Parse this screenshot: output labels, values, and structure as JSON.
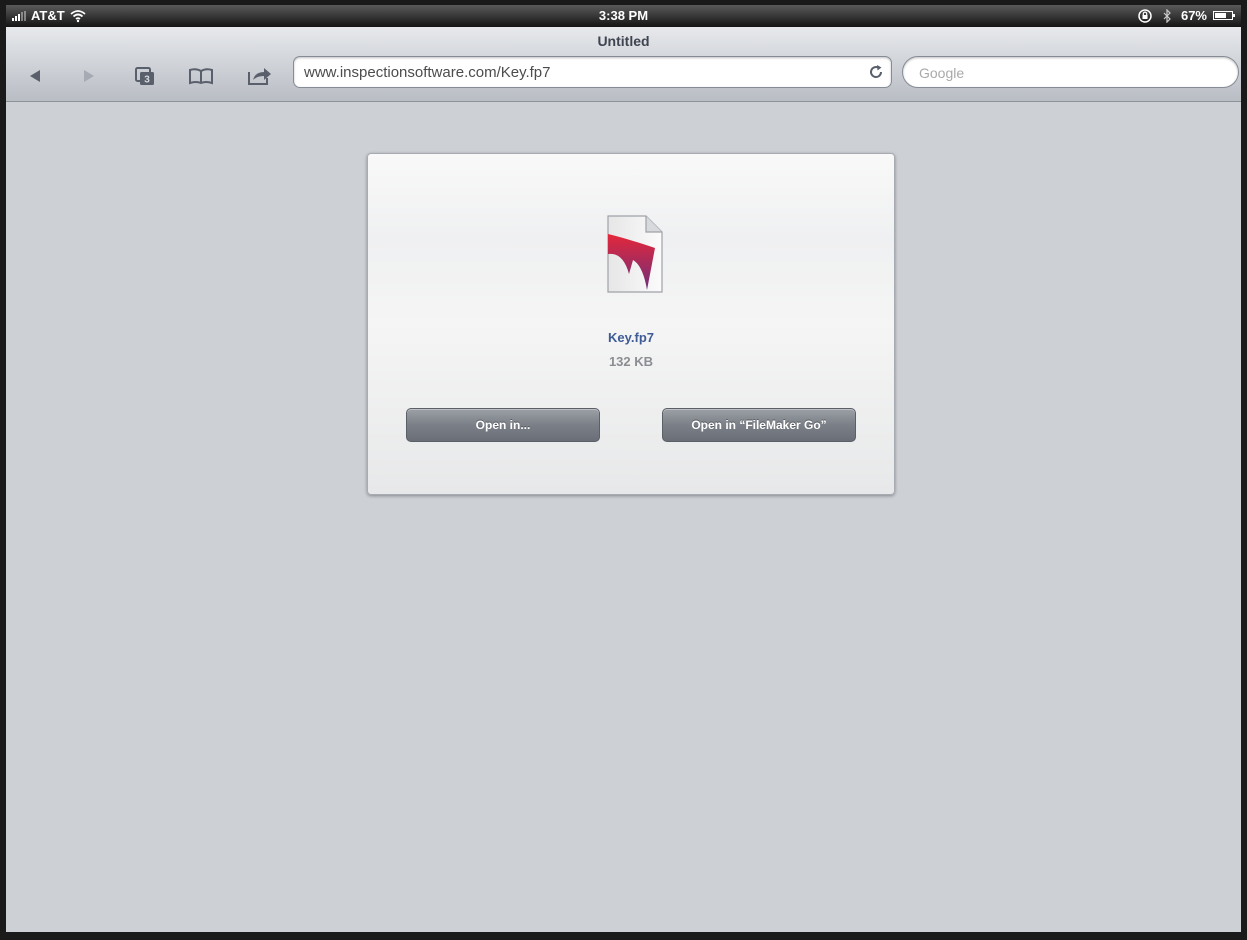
{
  "status_bar": {
    "carrier": "AT&T",
    "time": "3:38 PM",
    "battery": "67%",
    "battery_level": 0.67
  },
  "browser": {
    "page_title": "Untitled",
    "url": "www.inspectionsoftware.com/Key.fp7",
    "search_placeholder": "Google",
    "tab_count": "3"
  },
  "download": {
    "file_name": "Key.fp7",
    "file_size": "132 KB",
    "open_in_label": "Open in...",
    "open_in_app_label": "Open in “FileMaker Go”"
  },
  "icons": [
    "signal-icon",
    "wifi-icon",
    "lock-rotation-icon",
    "bluetooth-icon",
    "battery-icon",
    "back-icon",
    "forward-icon",
    "tabs-icon",
    "bookmarks-icon",
    "share-icon",
    "reload-icon",
    "file-icon"
  ],
  "colors": {
    "file_name": "#3e5b96",
    "content_bg": "#cdd0d5",
    "button": "#7b8088"
  }
}
